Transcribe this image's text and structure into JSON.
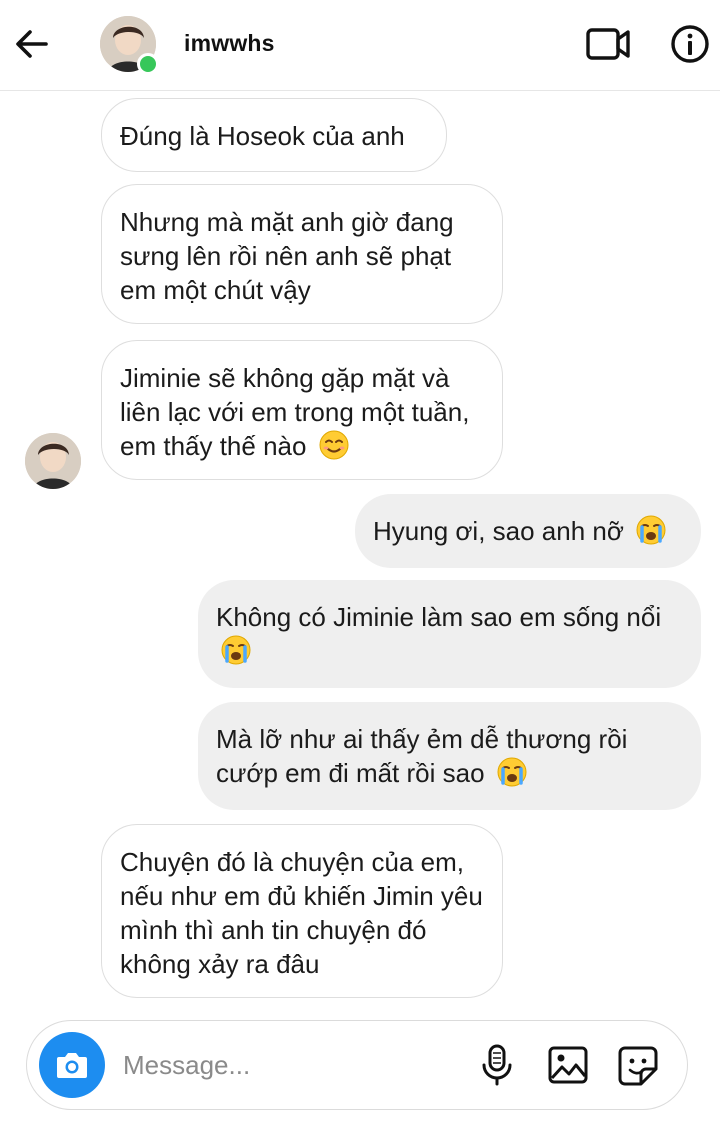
{
  "header": {
    "username": "imwwhs",
    "online": true
  },
  "messages": [
    {
      "direction": "in",
      "text": "Đúng là Hoseok của anh",
      "emoji": ""
    },
    {
      "direction": "in",
      "text": "Nhưng mà mặt anh giờ đang sưng lên rồi nên anh sẽ phạt em một chút vậy",
      "emoji": ""
    },
    {
      "direction": "in",
      "text": "Jiminie sẽ không gặp mặt và liên lạc với em trong một tuần, em thấy thế nào",
      "emoji": "smiling-face-emoji"
    },
    {
      "direction": "out",
      "text": "Hyung ơi, sao anh nỡ",
      "emoji": "crying-face-emoji"
    },
    {
      "direction": "out",
      "text": "Không có Jiminie làm sao em sống nổi",
      "emoji": "crying-face-emoji"
    },
    {
      "direction": "out",
      "text": "Mà lỡ như ai thấy ẻm dễ thương rồi cướp em đi mất rồi sao",
      "emoji": "crying-face-emoji"
    },
    {
      "direction": "in",
      "text": "Chuyện đó là chuyện của em, nếu như em đủ khiến Jimin yêu mình thì anh tin chuyện đó không xảy ra đâu",
      "emoji": ""
    }
  ],
  "composer": {
    "placeholder": "Message..."
  },
  "icons": {
    "back": "back-arrow-icon",
    "video": "video-call-icon",
    "info": "info-icon",
    "camera": "camera-icon",
    "mic": "microphone-icon",
    "gallery": "gallery-icon",
    "sticker": "sticker-icon"
  },
  "colors": {
    "online": "#37c75a",
    "camera_button": "#1d8df0",
    "outgoing_bubble": "#efefef",
    "incoming_border": "#dedede"
  }
}
